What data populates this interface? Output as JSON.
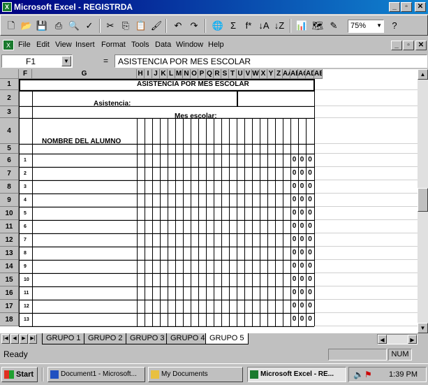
{
  "window": {
    "title": "Microsoft Excel - REGISTRDA",
    "min": "_",
    "max": "▫",
    "close": "✕"
  },
  "toolbar": {
    "zoom": "75%",
    "sum": "Σ",
    "fx": "f*"
  },
  "menu": {
    "items": [
      "File",
      "Edit",
      "View",
      "Insert",
      "Format",
      "Tools",
      "Data",
      "Window",
      "Help"
    ]
  },
  "formula_bar": {
    "name_box": "F1",
    "equals": "=",
    "content": "ASISTENCIA POR MES ESCOLAR"
  },
  "sheet": {
    "columns": [
      "F",
      "G",
      "H",
      "I",
      "J",
      "K",
      "L",
      "M",
      "N",
      "O",
      "P",
      "Q",
      "R",
      "S",
      "T",
      "U",
      "V",
      "W",
      "X",
      "Y",
      "Z",
      "AA",
      "AB",
      "AC",
      "AD",
      "AE"
    ],
    "rows": [
      "1",
      "2",
      "3",
      "4",
      "5",
      "6",
      "7",
      "8",
      "9",
      "10",
      "11",
      "12",
      "13",
      "14",
      "15",
      "16",
      "17",
      "18"
    ],
    "title": "ASISTENCIA POR MES ESCOLAR",
    "asistencia_label": "Asistencia:",
    "mes_label": "Mes escolar:",
    "nombre_label": "NOMBRE DEL ALUMNO",
    "zero": "0",
    "student_index": [
      "1",
      "2",
      "3",
      "4",
      "5",
      "6",
      "7",
      "8",
      "9",
      "10",
      "11",
      "12",
      "13"
    ]
  },
  "tabs": [
    "GRUPO 1",
    "GRUPO 2",
    "GRUPO 3",
    "GRUPO 4",
    "GRUPO 5"
  ],
  "active_tab": "GRUPO 5",
  "status": {
    "text": "Ready",
    "num": "NUM"
  },
  "taskbar": {
    "start": "Start",
    "buttons": [
      "Document1 - Microsoft...",
      "My Documents",
      "Microsoft Excel - RE..."
    ],
    "clock": "1:39 PM"
  }
}
